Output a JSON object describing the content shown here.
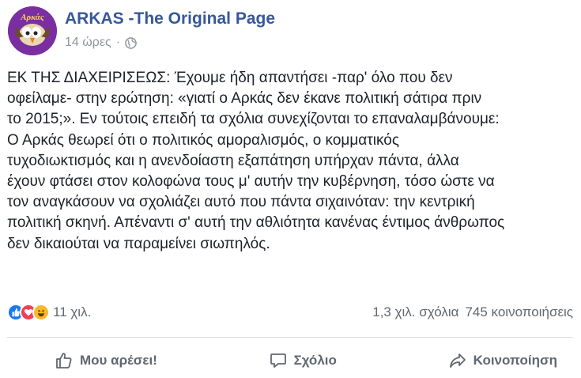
{
  "header": {
    "page_name": "ARKAS -The Original Page",
    "timestamp": "14 ώρες",
    "separator": "·",
    "privacy_icon": "globe-icon",
    "avatar_icon": "arkas-bird-logo"
  },
  "post": {
    "lines": [
      "ΕΚ ΤΗΣ ΔΙΑΧΕΙΡΙΣΕΩΣ: Έχουμε ήδη απαντήσει -παρ' όλο που δεν",
      "οφείλαμε- στην ερώτηση: «γιατί ο Αρκάς δεν έκανε πολιτική σάτιρα πριν",
      "το 2015;». Εν τούτοις επειδή τα σχόλια συνεχίζονται το επαναλαμβάνουμε:",
      "Ο Αρκάς θεωρεί ότι ο πολιτικός αμοραλισμός, ο κομματικός",
      "τυχοδιωκτισμός και η ανενδοίαστη εξαπάτηση υπήρχαν πάντα, άλλα",
      "έχουν φτάσει στον κολοφώνα τους μ' αυτήν την κυβέρνηση, τόσο ώστε να",
      "τον αναγκάσουν να σχολιάζει αυτό που πάντα σιχαινόταν: την κεντρική",
      "πολιτική σκηνή. Απέναντι σ' αυτή την αθλιότητα κανένας έντιμος άνθρωπος",
      "δεν δικαιούται να παραμείνει σιωπηλός."
    ]
  },
  "stats": {
    "reactions_count": "11 χιλ.",
    "comments": "1,3 χιλ. σχόλια",
    "shares": "745 κοινοποιήσεις",
    "reaction_icons": [
      "like-icon",
      "love-icon",
      "haha-icon"
    ],
    "colors": {
      "like": "#1877f2",
      "love": "#f33e58",
      "haha": "#f7b928"
    }
  },
  "actions": {
    "like": "Μου αρέσει!",
    "comment": "Σχόλιο",
    "share": "Κοινοποίηση"
  }
}
